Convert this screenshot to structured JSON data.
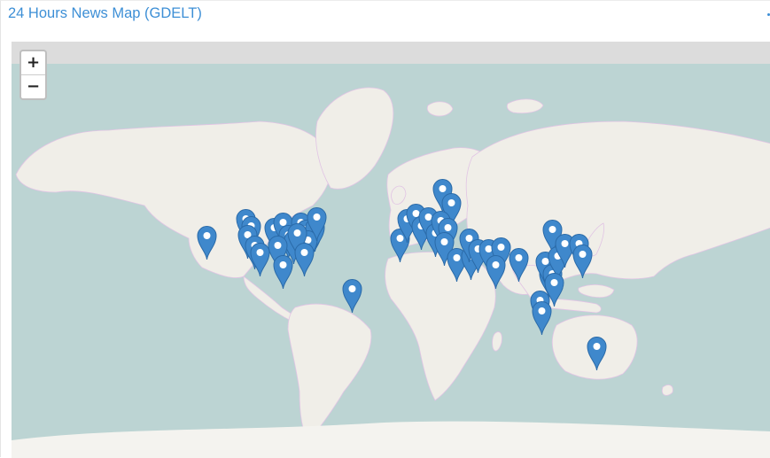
{
  "panel": {
    "title": "24 Hours News Map (GDELT)"
  },
  "map": {
    "zoom_in_label": "+",
    "zoom_out_label": "−",
    "colors": {
      "water": "#bcd4d3",
      "land": "#f0eee8",
      "borders": "#e1c4e4",
      "marker_fill": "#3f88cc",
      "marker_stroke": "#2a6aa8",
      "title_link": "#3d8fd6"
    },
    "marker_icon": "map-pin-icon",
    "markers": [
      {
        "region": "Hawaii"
      },
      {
        "region": "USA West Coast"
      },
      {
        "region": "USA West Coast"
      },
      {
        "region": "USA West Coast"
      },
      {
        "region": "USA West Coast"
      },
      {
        "region": "USA West Coast"
      },
      {
        "region": "USA Central"
      },
      {
        "region": "USA Central"
      },
      {
        "region": "USA Central"
      },
      {
        "region": "USA Central"
      },
      {
        "region": "USA Central"
      },
      {
        "region": "USA East"
      },
      {
        "region": "USA East"
      },
      {
        "region": "USA East"
      },
      {
        "region": "USA East"
      },
      {
        "region": "USA East"
      },
      {
        "region": "USA East"
      },
      {
        "region": "USA East"
      },
      {
        "region": "USA South"
      },
      {
        "region": "USA South"
      },
      {
        "region": "Brazil"
      },
      {
        "region": "Ireland"
      },
      {
        "region": "United Kingdom"
      },
      {
        "region": "United Kingdom"
      },
      {
        "region": "Scandinavia"
      },
      {
        "region": "Scandinavia"
      },
      {
        "region": "Spain"
      },
      {
        "region": "France"
      },
      {
        "region": "Italy"
      },
      {
        "region": "Germany"
      },
      {
        "region": "Poland"
      },
      {
        "region": "Balkans"
      },
      {
        "region": "Greece"
      },
      {
        "region": "Turkey"
      },
      {
        "region": "Ukraine"
      },
      {
        "region": "Middle East"
      },
      {
        "region": "Middle East"
      },
      {
        "region": "Middle East"
      },
      {
        "region": "Iran"
      },
      {
        "region": "Pakistan"
      },
      {
        "region": "India"
      },
      {
        "region": "India"
      },
      {
        "region": "Nepal"
      },
      {
        "region": "China"
      },
      {
        "region": "China"
      },
      {
        "region": "China"
      },
      {
        "region": "China"
      },
      {
        "region": "Philippines"
      },
      {
        "region": "Japan"
      },
      {
        "region": "Southeast Asia"
      },
      {
        "region": "Indonesia"
      },
      {
        "region": "Australia"
      }
    ]
  }
}
